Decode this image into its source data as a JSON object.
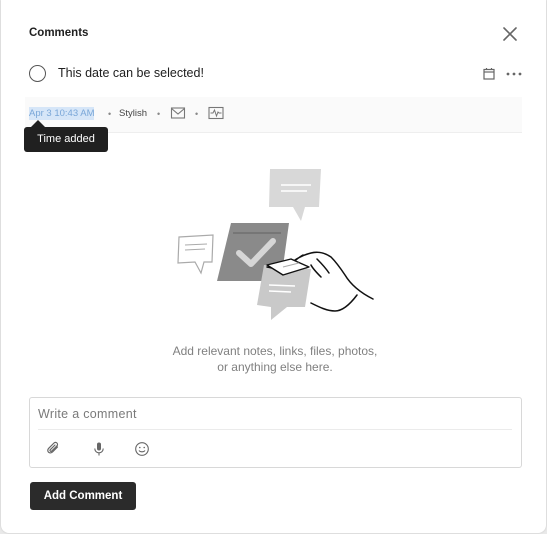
{
  "dialog": {
    "title": "Comments"
  },
  "task": {
    "name": "This date can be selected!"
  },
  "meta": {
    "time_added": "Apr 3 10:43 AM",
    "separator": "•",
    "project": "Stylish"
  },
  "tooltip": {
    "text": "Time added"
  },
  "empty_state": {
    "line1": "Add relevant notes, links, files, photos,",
    "line2": "or anything else here."
  },
  "comment": {
    "placeholder": "Write a comment",
    "value": ""
  },
  "actions": {
    "add_comment_label": "Add Comment"
  },
  "icons": {
    "close": "close-icon",
    "calendar": "calendar-icon",
    "more": "more-horizontal-icon",
    "mail": "mail-icon",
    "activity": "activity-icon",
    "attach": "paperclip-icon",
    "mic": "microphone-icon",
    "emoji": "smiley-icon"
  },
  "colors": {
    "button_bg": "#2b2b2b",
    "selection_bg": "#d6e6f8",
    "selection_text": "#7aa7d8",
    "tooltip_bg": "#202020"
  }
}
